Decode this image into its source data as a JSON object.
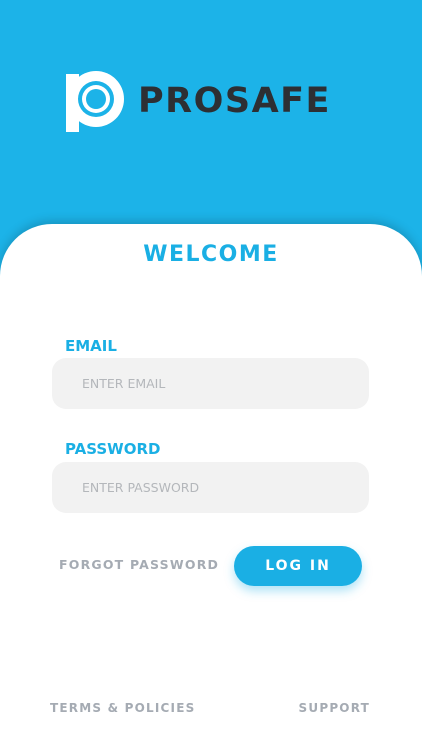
{
  "brand": {
    "name": "PROSAFE",
    "logo_icon": "prosafe-p-mark-icon",
    "colors": {
      "primary": "#1cb3e8",
      "accent": "#1aafe4",
      "dark_text": "#2d2f33",
      "muted_text": "#a5abb3"
    }
  },
  "login": {
    "heading": "WELCOME",
    "email_label": "EMAIL",
    "email_placeholder": "ENTER EMAIL",
    "email_value": "",
    "password_label": "PASSWORD",
    "password_placeholder": "ENTER PASSWORD",
    "password_value": "",
    "forgot_password": "FORGOT PASSWORD",
    "login_button": "LOG IN"
  },
  "footer": {
    "terms": "TERMS & POLICIES",
    "support": "SUPPORT"
  }
}
